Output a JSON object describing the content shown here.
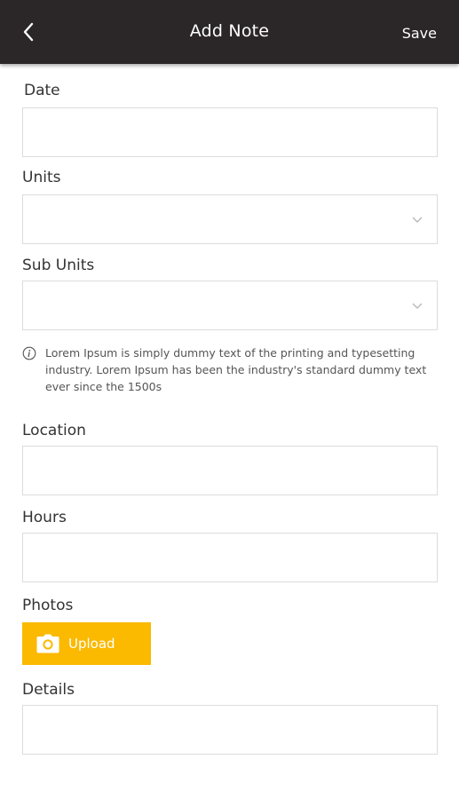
{
  "header": {
    "title": "Add Note",
    "save_label": "Save",
    "back_icon": "chevron-left-icon"
  },
  "form": {
    "date_label": "Date",
    "units_label": "Units",
    "sub_units_label": "Sub Units",
    "info_text": "Lorem Ipsum is simply dummy text of the printing and typesetting industry. Lorem Ipsum has been the industry's standard dummy text ever since the 1500s",
    "location_label": "Location",
    "hours_label": "Hours",
    "photos_label": "Photos",
    "upload_label": "Upload",
    "details_label": "Details"
  },
  "colors": {
    "header_bg": "#2b2627",
    "upload_bg": "#fbb900",
    "field_border": "#dcdcdc"
  }
}
